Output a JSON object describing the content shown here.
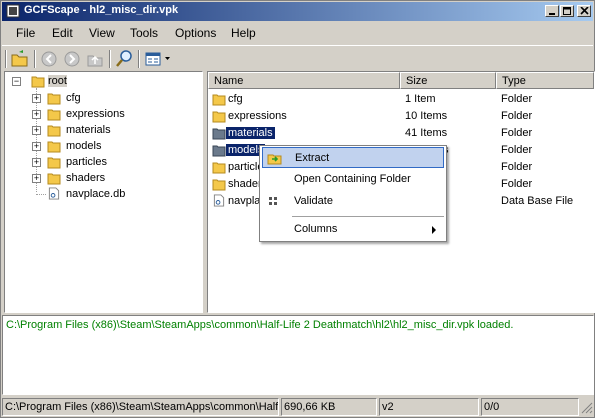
{
  "window": {
    "title": "GCFScape - hl2_misc_dir.vpk"
  },
  "menubar": [
    "File",
    "Edit",
    "View",
    "Tools",
    "Options",
    "Help"
  ],
  "tree": {
    "root": "root",
    "children": [
      "cfg",
      "expressions",
      "materials",
      "models",
      "particles",
      "shaders",
      "navplace.db"
    ]
  },
  "list": {
    "columns": [
      "Name",
      "Size",
      "Type"
    ],
    "rows": [
      {
        "name": "cfg",
        "size": "1 Item",
        "type": "Folder"
      },
      {
        "name": "expressions",
        "size": "10 Items",
        "type": "Folder"
      },
      {
        "name": "materials",
        "size": "41 Items",
        "type": "Folder"
      },
      {
        "name": "models",
        "size": "s",
        "type": "Folder"
      },
      {
        "name": "particle",
        "size": "",
        "type": "Folder"
      },
      {
        "name": "shader",
        "size": "",
        "type": "Folder"
      },
      {
        "name": "navpla",
        "size": "",
        "type": "Data Base File"
      }
    ]
  },
  "context_menu": {
    "items": [
      "Extract",
      "Open Containing Folder",
      "Validate",
      "Columns"
    ]
  },
  "log": {
    "line": "C:\\Program Files (x86)\\Steam\\SteamApps\\common\\Half-Life 2 Deathmatch\\hl2\\hl2_misc_dir.vpk loaded."
  },
  "statusbar": {
    "path": "C:\\Program Files (x86)\\Steam\\SteamApps\\common\\Half-L",
    "size": "690,66 KB",
    "version": "v2",
    "count": "0/0"
  },
  "colors": {
    "selection": "#0a246a",
    "log_text": "#008000",
    "folder": "#f4c84a"
  }
}
